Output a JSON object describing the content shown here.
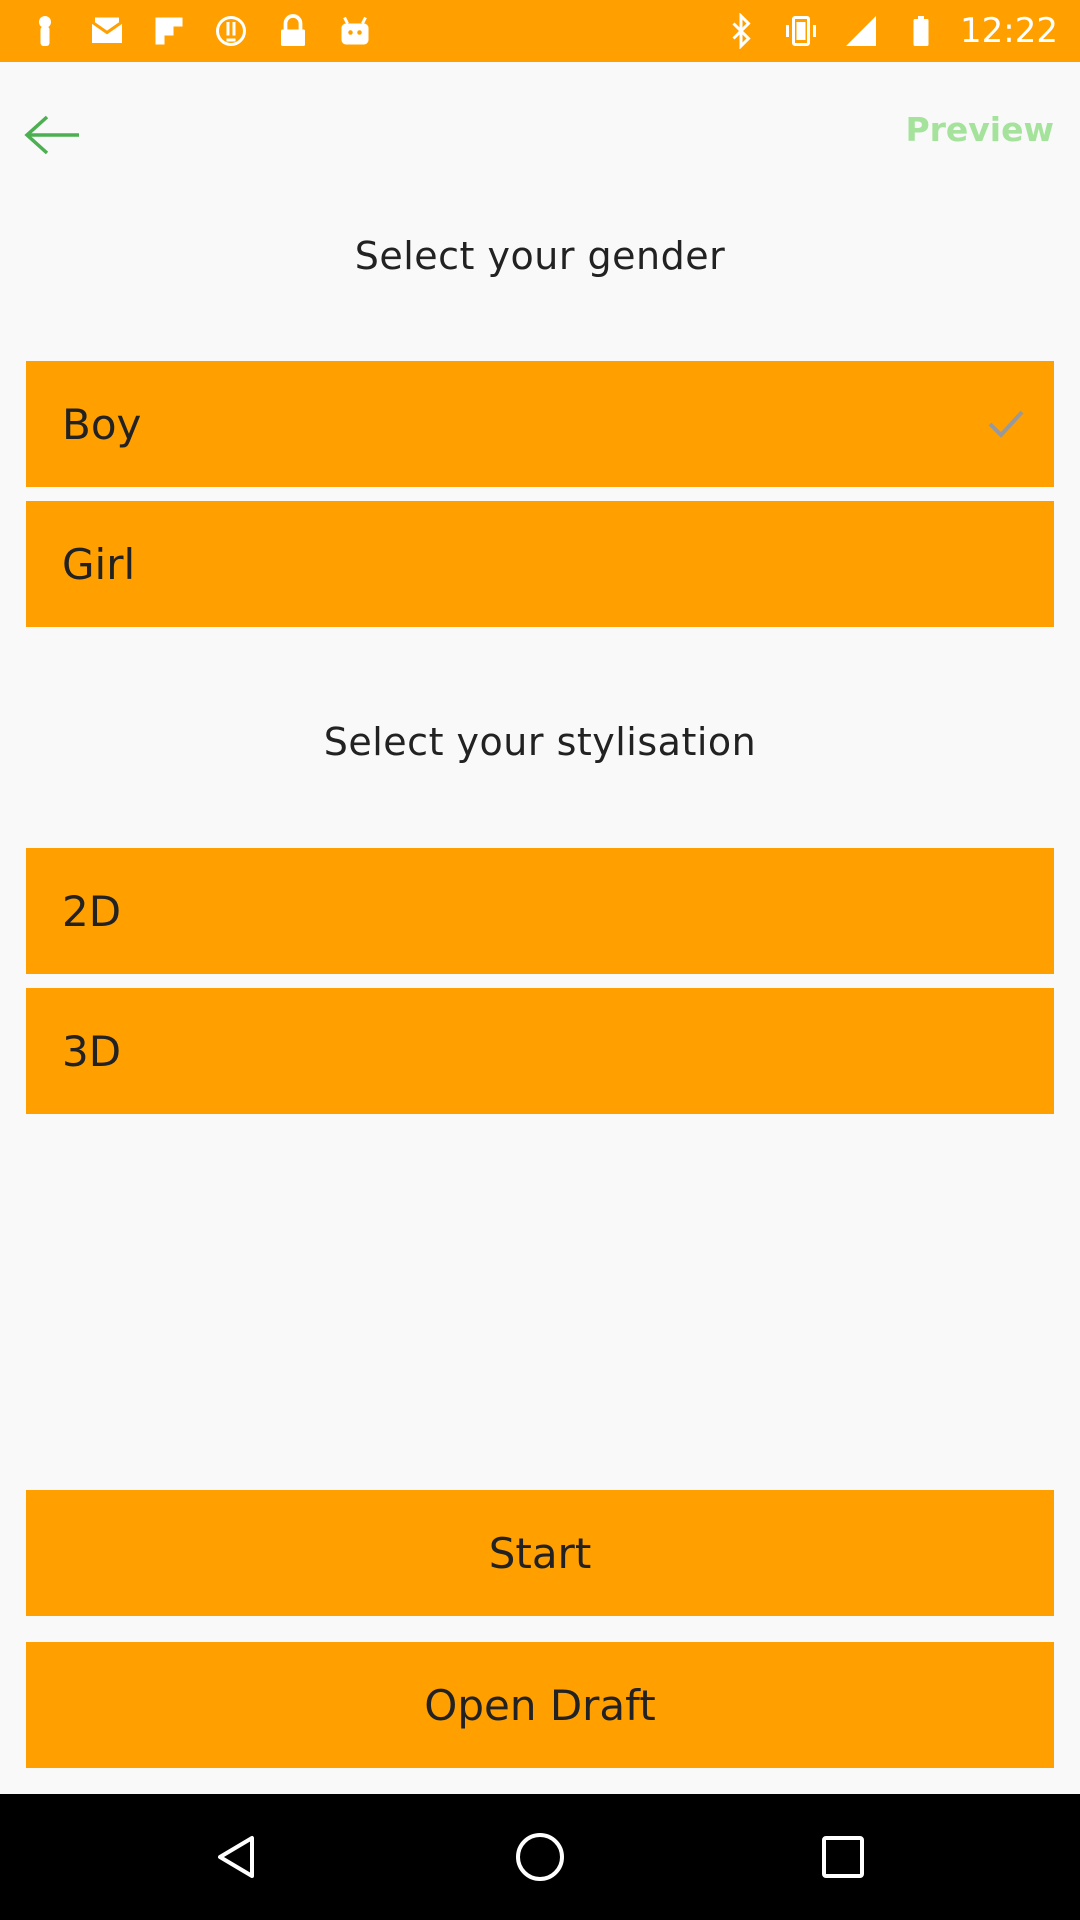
{
  "status_bar": {
    "time": "12:22",
    "left_icons": [
      "notification-icon-1",
      "mail-icon",
      "flipboard-icon",
      "alert-icon",
      "lock-icon",
      "android-icon"
    ],
    "right_icons": [
      "bluetooth-icon",
      "vibrate-icon",
      "signal-icon",
      "battery-icon"
    ]
  },
  "app_bar": {
    "back_icon": "arrow-back-icon",
    "preview_label": "Preview",
    "accent_color": "#a5e29c"
  },
  "gender_section": {
    "heading": "Select your gender",
    "options": [
      {
        "label": "Boy",
        "selected": true
      },
      {
        "label": "Girl",
        "selected": false
      }
    ]
  },
  "style_section": {
    "heading": "Select your stylisation",
    "options": [
      {
        "label": "2D",
        "selected": false
      },
      {
        "label": "3D",
        "selected": false
      }
    ]
  },
  "actions": {
    "start_label": "Start",
    "open_draft_label": "Open Draft"
  },
  "colors": {
    "primary": "#ffa000",
    "background": "#f9f9f9"
  },
  "nav_bar": {
    "icons": [
      "back-triangle-icon",
      "home-circle-icon",
      "recents-square-icon"
    ]
  }
}
